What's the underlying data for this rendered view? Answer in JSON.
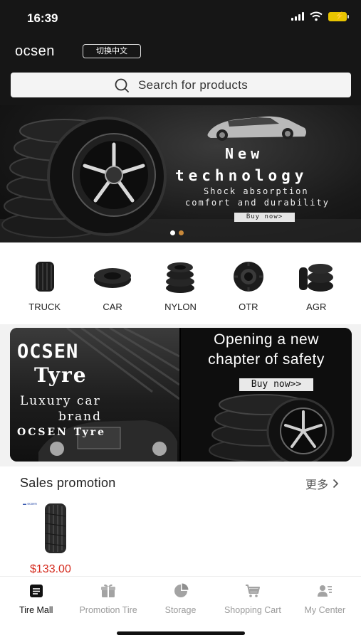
{
  "status_bar": {
    "time": "16:39"
  },
  "header": {
    "brand": "ocsen",
    "lang_button": "切换中文",
    "search_placeholder": "Search for products"
  },
  "hero": {
    "line1": "New",
    "line2": "technology",
    "sub1": "Shock absorption",
    "sub2": "comfort and durability",
    "button": "Buy now>",
    "slides": 2,
    "active_slide": 2
  },
  "categories": [
    {
      "label": "TRUCK",
      "icon": "truck-tire-icon"
    },
    {
      "label": "CAR",
      "icon": "car-tire-icon"
    },
    {
      "label": "NYLON",
      "icon": "nylon-tire-icon"
    },
    {
      "label": "OTR",
      "icon": "otr-tire-icon"
    },
    {
      "label": "AGR",
      "icon": "agr-tire-icon"
    }
  ],
  "promo_banner": {
    "left": {
      "brand": "OCSEN",
      "tyre": "Tyre",
      "lux1": "Luxury car",
      "lux2": "brand",
      "lux3": "OCSEN Tyre"
    },
    "right": {
      "title1": "Opening a new",
      "title2": "chapter of safety",
      "button": "Buy now>>"
    }
  },
  "sales": {
    "title": "Sales promotion",
    "more": "更多",
    "products": [
      {
        "price": "$133.00"
      }
    ]
  },
  "tabbar": {
    "active": "Tire Mall",
    "items": [
      {
        "label": "Tire Mall",
        "icon": "tire-mall-icon"
      },
      {
        "label": "Promotion Tire",
        "icon": "gift-icon"
      },
      {
        "label": "Storage",
        "icon": "pie-chart-icon"
      },
      {
        "label": "Shopping Cart",
        "icon": "cart-icon"
      },
      {
        "label": "My Center",
        "icon": "profile-card-icon"
      }
    ]
  },
  "colors": {
    "header_bg": "#161616",
    "price": "#d52b1e",
    "active_dot": "#c9893a",
    "battery": "#e8c400"
  }
}
